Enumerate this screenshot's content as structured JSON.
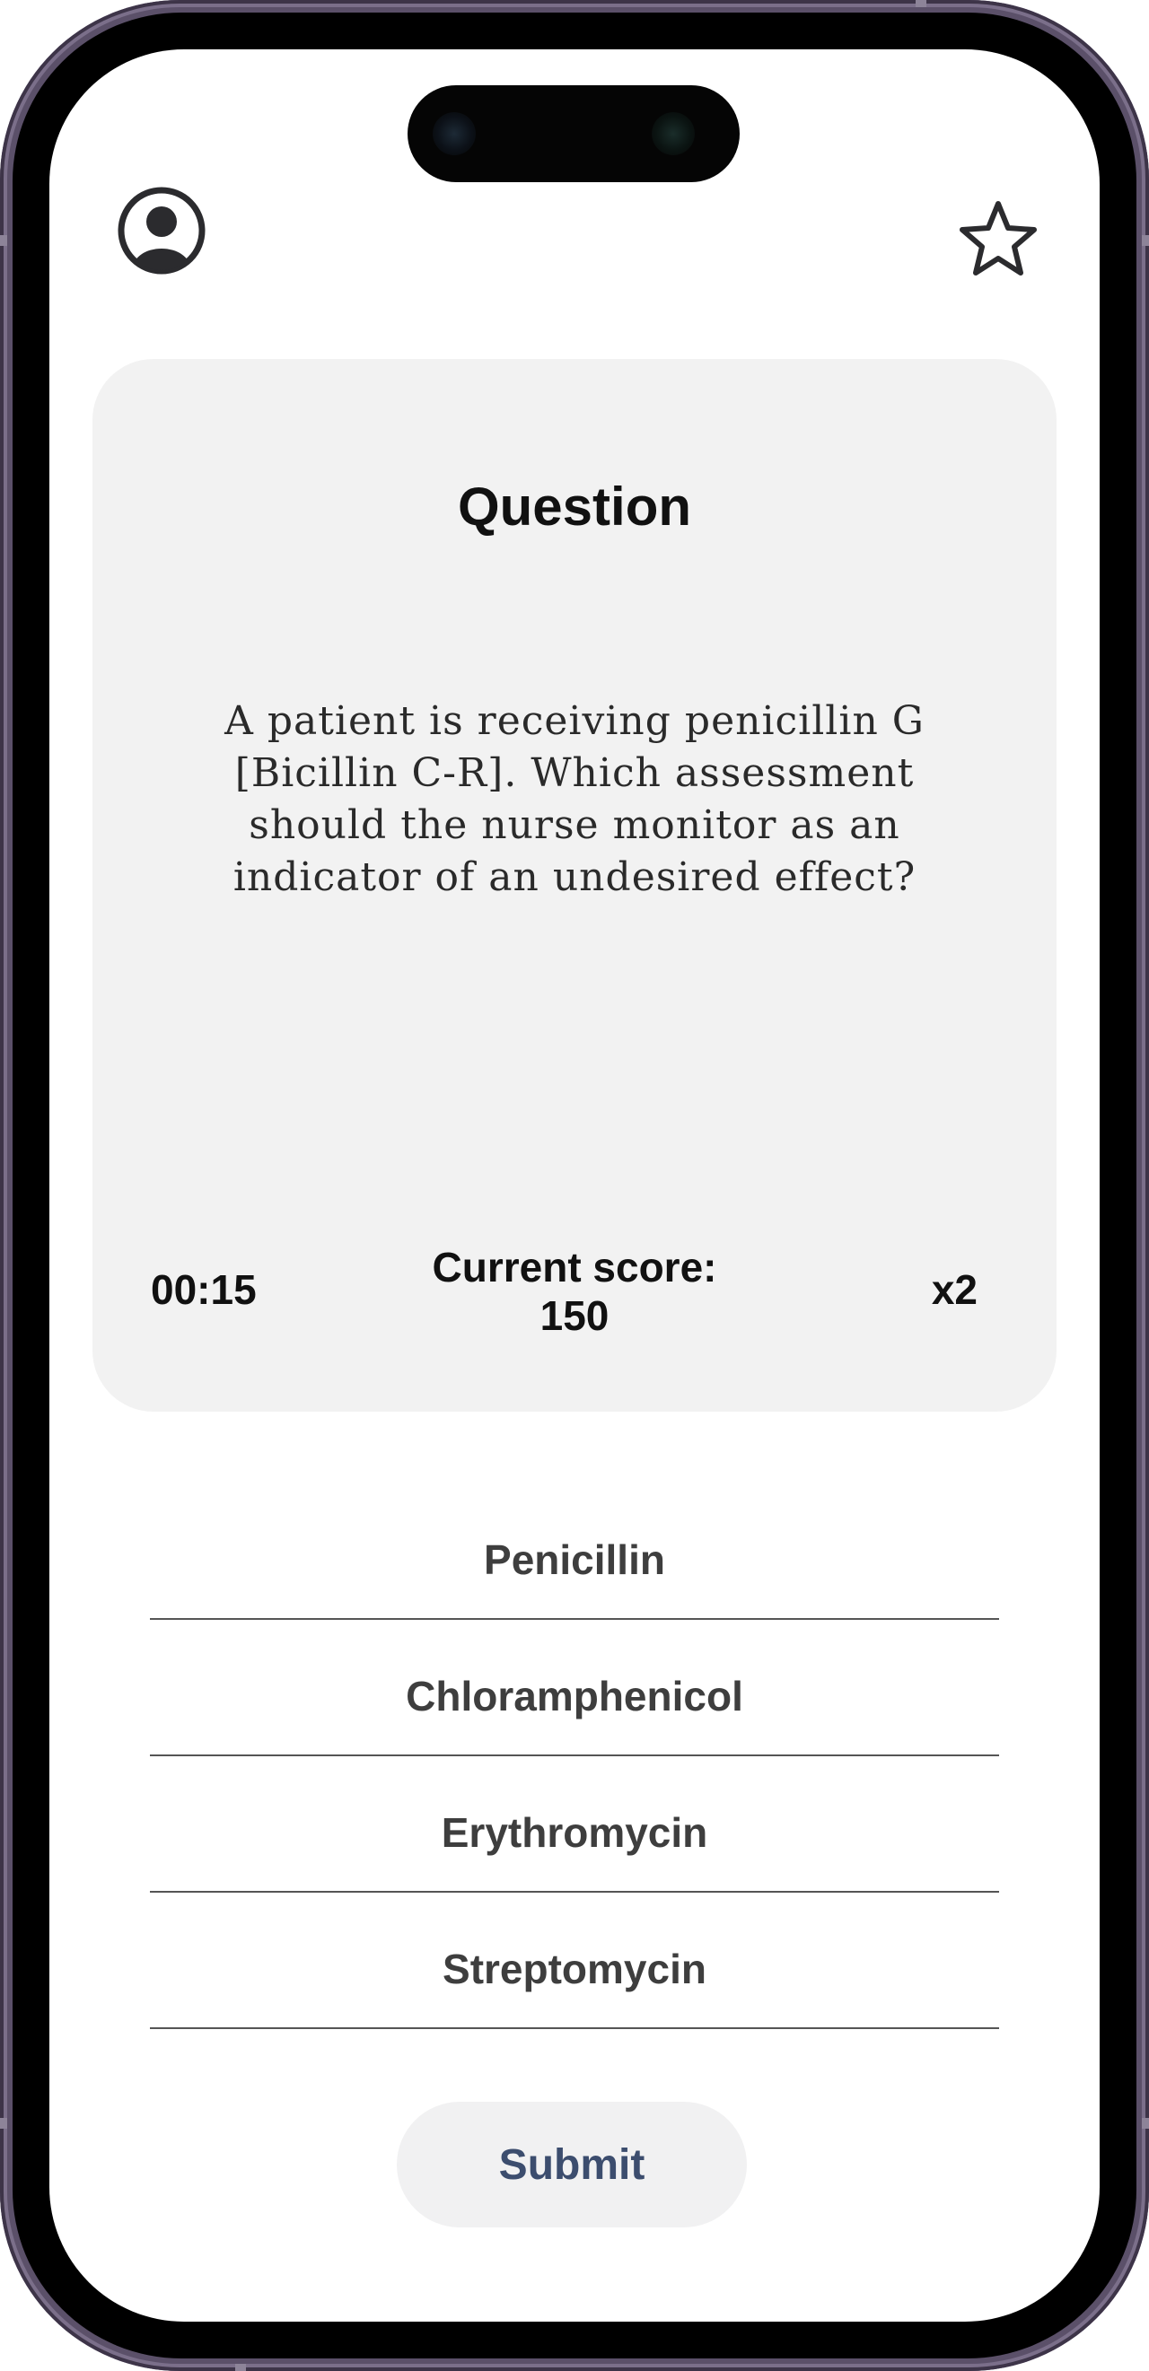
{
  "header": {
    "profile_icon": "user-circle-icon",
    "favorite_icon": "star-outline-icon"
  },
  "question_card": {
    "title": "Question",
    "text": "A patient is receiving penicillin G [Bicillin C-R]. Which assessment should the nurse monitor as an indicator of an undesired effect?",
    "timer": "00:15",
    "score_label": "Current score:",
    "score_value": "150",
    "multiplier": "x2"
  },
  "options": [
    {
      "label": "Penicillin"
    },
    {
      "label": "Chloramphenicol"
    },
    {
      "label": "Erythromycin"
    },
    {
      "label": "Streptomycin"
    }
  ],
  "submit_label": "Submit",
  "colors": {
    "card_background": "#f2f2f2",
    "submit_text": "#3c4d6e",
    "phone_frame": "#5b5069"
  }
}
